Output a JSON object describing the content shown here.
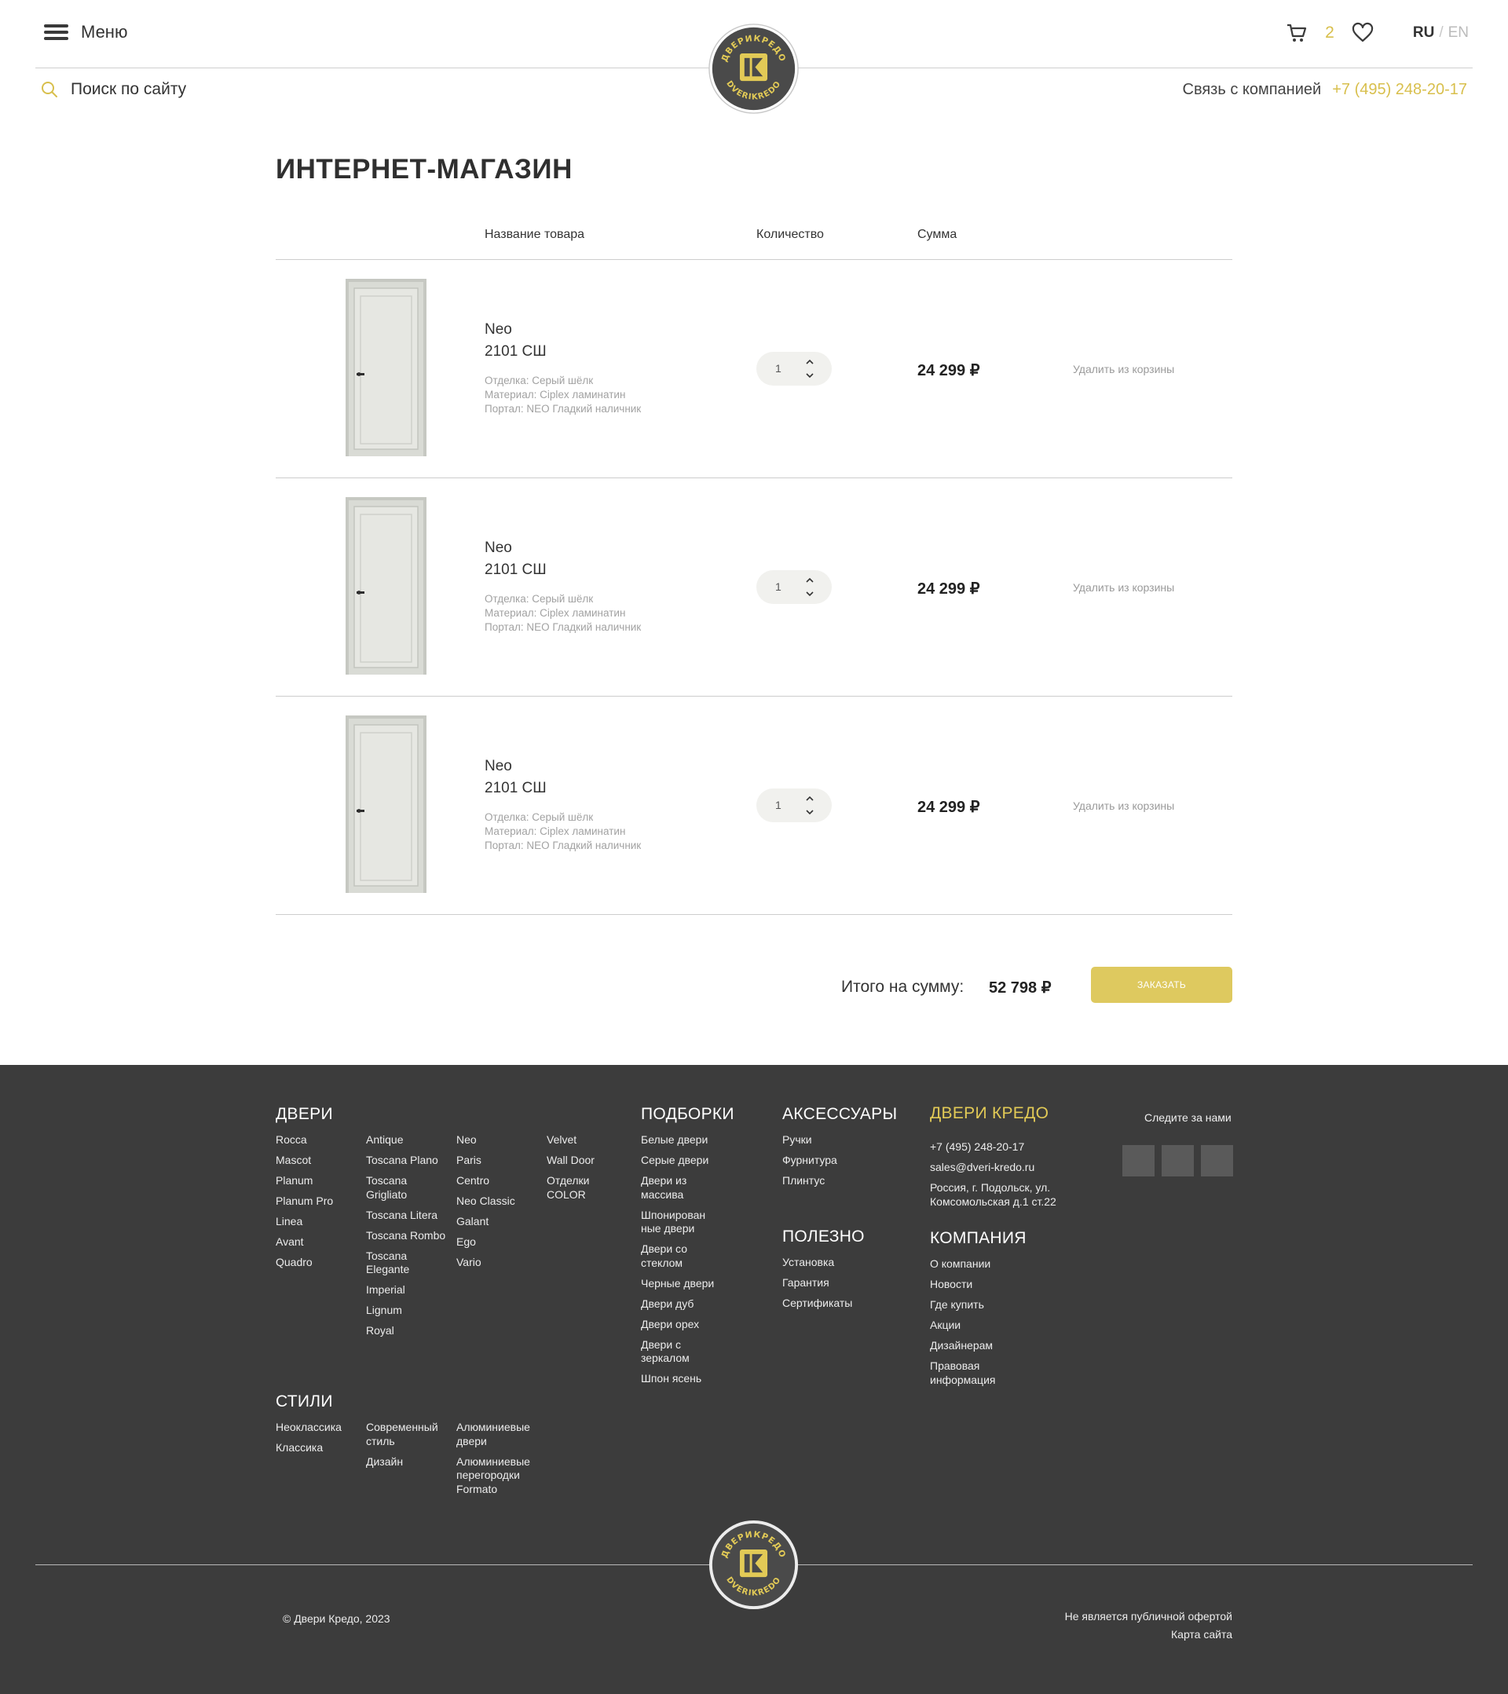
{
  "header": {
    "menu_label": "Меню",
    "search_placeholder": "Поиск по сайту",
    "cart_count": "2",
    "lang_active": "RU",
    "lang_sep": "/",
    "lang_other": "EN",
    "contact_label": "Связь с компанией",
    "phone": "+7 (495) 248-20-17",
    "logo_text_top": "ДВЕРИКРЕДО",
    "logo_text_bottom": "DVERIKREDO"
  },
  "colors": {
    "accent": "#dec95f",
    "gold_text": "#d8bf4c",
    "footer_bg": "#3c3c3c",
    "logo_bg": "#4a4a4a"
  },
  "page_title": "ИНТЕРНЕТ-МАГАЗИН",
  "cart": {
    "columns": {
      "name": "Название товара",
      "qty": "Количество",
      "sum": "Сумма"
    },
    "items": [
      {
        "series": "Neo",
        "model": "2101 СШ",
        "finish": "Отделка: Серый шёлк",
        "material": "Материал: Ciplex ламинатин",
        "portal": "Портал: NEO Гладкий наличник",
        "qty": "1",
        "price": "24 299 ₽",
        "remove": "Удалить из корзины"
      },
      {
        "series": "Neo",
        "model": "2101 СШ",
        "finish": "Отделка: Серый шёлк",
        "material": "Материал: Ciplex ламинатин",
        "portal": "Портал: NEO Гладкий наличник",
        "qty": "1",
        "price": "24 299 ₽",
        "remove": "Удалить из корзины"
      },
      {
        "series": "Neo",
        "model": "2101 СШ",
        "finish": "Отделка: Серый шёлк",
        "material": "Материал: Ciplex ламинатин",
        "portal": "Портал: NEO Гладкий наличник",
        "qty": "1",
        "price": "24 299 ₽",
        "remove": "Удалить из корзины"
      }
    ],
    "total_label": "Итого на сумму:",
    "total_value": "52 798 ₽",
    "order_button": "ЗАКАЗАТЬ"
  },
  "footer": {
    "doors_title": "ДВЕРИ",
    "doors_col1": [
      "Rocca",
      "Mascot",
      "Planum",
      "Planum Pro",
      "Linea",
      "Avant",
      "Quadro"
    ],
    "doors_col2": [
      "Antique",
      "Toscana Plano",
      "Toscana Grigliato",
      "Toscana Litera",
      "Toscana Rombo",
      "Toscana Elegante",
      "Imperial",
      "Lignum",
      "Royal"
    ],
    "doors_col3": [
      "Neo",
      "Paris",
      "Centro",
      "Neo Classic",
      "Galant",
      "Ego",
      "Vario"
    ],
    "doors_col4": [
      "Velvet",
      "Wall Door",
      "Отделки COLOR"
    ],
    "styles_title": "СТИЛИ",
    "styles_col1": [
      "Неоклассика",
      "Классика"
    ],
    "styles_col2": [
      "Современный стиль",
      "Дизайн"
    ],
    "styles_col3": [
      "Алюминиевые двери",
      "Алюминиевые перегородки Formato"
    ],
    "selections_title": "ПОДБОРКИ",
    "selections": [
      "Белые двери",
      "Серые двери",
      "Двери из массива",
      "Шпонирован ные двери",
      "Двери со стеклом",
      "Черные двери",
      "Двери дуб",
      "Двери орех",
      "Двери с зеркалом",
      "Шпон ясень"
    ],
    "accessories_title": "АКСЕССУАРЫ",
    "accessories": [
      "Ручки",
      "Фурнитура",
      "Плинтус"
    ],
    "useful_title": "ПОЛЕЗНО",
    "useful": [
      "Установка",
      "Гарантия",
      "Сертификаты"
    ],
    "brand_title": "ДВЕРИ КРЕДО",
    "brand_contacts": [
      "+7 (495) 248-20-17",
      "sales@dveri-kredo.ru",
      "Россия, г. Подольск, ул. Комсомольская д.1 ст.22"
    ],
    "company_title": "КОМПАНИЯ",
    "company": [
      "О компании",
      "Новости",
      "Где купить",
      "Акции",
      "Дизайнерам",
      "Правовая информация"
    ],
    "follow": "Следите за нами",
    "copyright": "© Двери Кредо, 2023",
    "legal_note": "Не является публичной офертой",
    "sitemap": "Карта сайта"
  }
}
